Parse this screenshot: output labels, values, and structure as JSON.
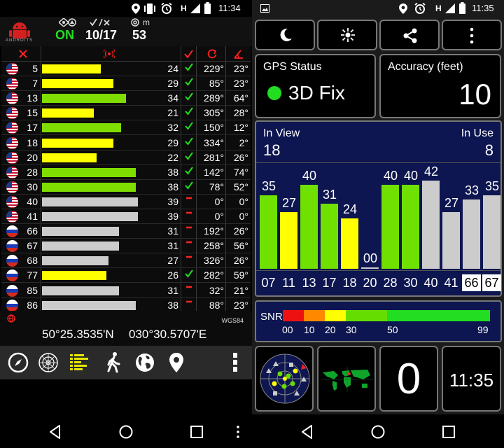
{
  "left": {
    "status": {
      "time": "11:34",
      "h": "H"
    },
    "header": {
      "fix_status": "ON",
      "sat_count": "10/17",
      "unit": "m",
      "accuracy": "53",
      "logo_text": "ANDROITS"
    },
    "rows": [
      {
        "flag": "us",
        "prn": "5",
        "snr": "24",
        "used": true,
        "az": "229°",
        "el": "23°",
        "bar": 0.56,
        "color": "#ffff00"
      },
      {
        "flag": "us",
        "prn": "7",
        "snr": "29",
        "used": true,
        "az": "85°",
        "el": "23°",
        "bar": 0.68,
        "color": "#ffff00"
      },
      {
        "flag": "us",
        "prn": "13",
        "snr": "34",
        "used": true,
        "az": "289°",
        "el": "64°",
        "bar": 0.8,
        "color": "#7fdd00"
      },
      {
        "flag": "us",
        "prn": "15",
        "snr": "21",
        "used": true,
        "az": "305°",
        "el": "28°",
        "bar": 0.49,
        "color": "#ffff00"
      },
      {
        "flag": "us",
        "prn": "17",
        "snr": "32",
        "used": true,
        "az": "150°",
        "el": "12°",
        "bar": 0.75,
        "color": "#7fdd00"
      },
      {
        "flag": "us",
        "prn": "18",
        "snr": "29",
        "used": true,
        "az": "334°",
        "el": "2°",
        "bar": 0.68,
        "color": "#ffff00"
      },
      {
        "flag": "us",
        "prn": "20",
        "snr": "22",
        "used": true,
        "az": "281°",
        "el": "26°",
        "bar": 0.52,
        "color": "#ffff00"
      },
      {
        "flag": "us",
        "prn": "28",
        "snr": "38",
        "used": true,
        "az": "142°",
        "el": "74°",
        "bar": 0.89,
        "color": "#7fdd00"
      },
      {
        "flag": "us",
        "prn": "30",
        "snr": "38",
        "used": true,
        "az": "78°",
        "el": "52°",
        "bar": 0.89,
        "color": "#7fdd00"
      },
      {
        "flag": "us",
        "prn": "40",
        "snr": "39",
        "used": false,
        "az": "0°",
        "el": "0°",
        "bar": 0.91,
        "color": "#cccccc"
      },
      {
        "flag": "us",
        "prn": "41",
        "snr": "39",
        "used": false,
        "az": "0°",
        "el": "0°",
        "bar": 0.91,
        "color": "#cccccc"
      },
      {
        "flag": "ru",
        "prn": "66",
        "snr": "31",
        "used": false,
        "az": "192°",
        "el": "26°",
        "bar": 0.73,
        "color": "#cccccc"
      },
      {
        "flag": "ru",
        "prn": "67",
        "snr": "31",
        "used": false,
        "az": "258°",
        "el": "56°",
        "bar": 0.73,
        "color": "#cccccc"
      },
      {
        "flag": "ru",
        "prn": "68",
        "snr": "27",
        "used": false,
        "az": "326°",
        "el": "26°",
        "bar": 0.63,
        "color": "#cccccc"
      },
      {
        "flag": "ru",
        "prn": "77",
        "snr": "26",
        "used": true,
        "az": "282°",
        "el": "59°",
        "bar": 0.61,
        "color": "#ffff00"
      },
      {
        "flag": "ru",
        "prn": "85",
        "snr": "31",
        "used": false,
        "az": "32°",
        "el": "21°",
        "bar": 0.73,
        "color": "#cccccc"
      },
      {
        "flag": "ru",
        "prn": "86",
        "snr": "38",
        "used": false,
        "az": "88°",
        "el": "23°",
        "bar": 0.89,
        "color": "#cccccc"
      }
    ],
    "coords": {
      "lat": "50°25.3535'N",
      "lon": "030°30.5707'E",
      "datum": "WGS84"
    },
    "colors": {
      "check": "#22dd22",
      "dash": "#ff2222",
      "header_icon": "#ff2222"
    }
  },
  "right": {
    "status": {
      "time": "11:35",
      "h": "H"
    },
    "gps_status": {
      "label": "GPS Status",
      "value": "3D Fix",
      "dot_color": "#22dd22"
    },
    "accuracy": {
      "label": "Accuracy (feet)",
      "value": "10"
    },
    "sky": {
      "in_view_label": "In View",
      "in_view": "18",
      "in_use_label": "In Use",
      "in_use": "8"
    },
    "chart_data": {
      "type": "bar",
      "categories": [
        "07",
        "11",
        "13",
        "17",
        "18",
        "20",
        "28",
        "30",
        "40",
        "41",
        "66",
        "67"
      ],
      "values": [
        35,
        27,
        40,
        31,
        24,
        0,
        40,
        40,
        42,
        27,
        33,
        35
      ],
      "labels": [
        "35",
        "27",
        "40",
        "31",
        "24",
        "00",
        "40",
        "40",
        "42",
        "27",
        "33",
        "35"
      ],
      "colors": [
        "#6fe000",
        "#ffff00",
        "#6fe000",
        "#6fe000",
        "#ffff00",
        "#cccccc",
        "#6fe000",
        "#6fe000",
        "#cccccc",
        "#cccccc",
        "#cccccc",
        "#cccccc"
      ],
      "inverted": [
        false,
        false,
        false,
        false,
        false,
        false,
        false,
        false,
        false,
        false,
        true,
        true
      ],
      "ylim": [
        0,
        50
      ]
    },
    "snr": {
      "label": "SNR",
      "ticks": [
        "00",
        "10",
        "20",
        "30",
        "50",
        "99"
      ]
    },
    "clock": {
      "fix_count": "0",
      "time": "11:35"
    }
  }
}
